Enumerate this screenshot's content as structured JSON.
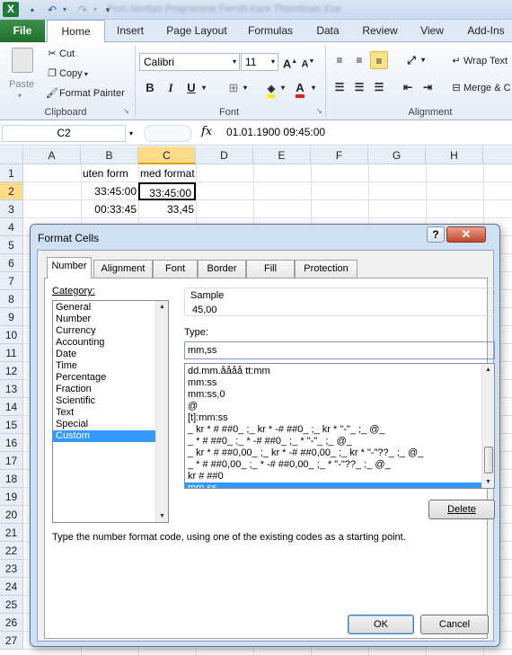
{
  "titlebar": {
    "title": "Finn Nordan Programme Ferrell Kare Thomfouer Exe"
  },
  "ribbon": {
    "tabs": {
      "file": "File",
      "home": "Home",
      "insert": "Insert",
      "page_layout": "Page Layout",
      "formulas": "Formulas",
      "data": "Data",
      "review": "Review",
      "view": "View",
      "addins": "Add-Ins"
    },
    "clipboard": {
      "paste": "Paste",
      "cut": "Cut",
      "copy": "Copy",
      "format_painter": "Format Painter",
      "label": "Clipboard"
    },
    "font": {
      "name": "Calibri",
      "size": "11",
      "label": "Font",
      "bold": "B",
      "italic": "I",
      "underline": "U"
    },
    "alignment": {
      "wrap_text": "Wrap Text",
      "merge": "Merge & C",
      "label": "Alignment"
    }
  },
  "formula_bar": {
    "name_box": "C2",
    "fx": "fx",
    "formula": "01.01.1900  09:45:00"
  },
  "sheet": {
    "columns": [
      "A",
      "B",
      "C",
      "D",
      "E",
      "F",
      "G",
      "H"
    ],
    "rows": [
      "1",
      "2",
      "3",
      "4",
      "5",
      "6",
      "7",
      "8",
      "9",
      "10",
      "11",
      "12",
      "13",
      "14",
      "15",
      "16",
      "17",
      "18",
      "19",
      "20",
      "21",
      "22",
      "23",
      "24",
      "25",
      "26",
      "27"
    ],
    "cells": {
      "B1": "uten form",
      "C1": "med format",
      "B2": "33:45:00",
      "C2": "33:45:00",
      "B3": "00:33:45",
      "C3": "33,45"
    }
  },
  "dialog": {
    "title": "Format Cells",
    "help": "?",
    "close": "✕",
    "tabs": [
      "Number",
      "Alignment",
      "Font",
      "Border",
      "Fill",
      "Protection"
    ],
    "category_label": "Category:",
    "categories": [
      "General",
      "Number",
      "Currency",
      "Accounting",
      "Date",
      "Time",
      "Percentage",
      "Fraction",
      "Scientific",
      "Text",
      "Special",
      "Custom"
    ],
    "selected_category": "Custom",
    "sample_label": "Sample",
    "sample_value": "45,00",
    "type_label": "Type:",
    "type_value": "mm,ss",
    "formats": [
      "dd.mm.åååå tt:mm",
      "mm:ss",
      "mm:ss,0",
      "@",
      "[t]:mm:ss",
      "_ kr * # ##0_ ;_ kr * -# ##0_ ;_ kr * \"-\"_ ;_ @_",
      "_ * # ##0_ ;_ * -# ##0_ ;_ * \"-\"_ ;_ @_",
      "_ kr * # ##0,00_ ;_ kr * -# ##0,00_ ;_ kr * \"-\"??_ ;_ @_",
      "_ * # ##0,00_ ;_ * -# ##0,00_ ;_ * \"-\"??_ ;_ @_",
      "kr # ##0",
      "mm,ss"
    ],
    "selected_format": "mm,ss",
    "delete_button": "Delete",
    "description": "Type the number format code, using one of the existing codes as a starting point.",
    "ok_button": "OK",
    "cancel_button": "Cancel"
  }
}
